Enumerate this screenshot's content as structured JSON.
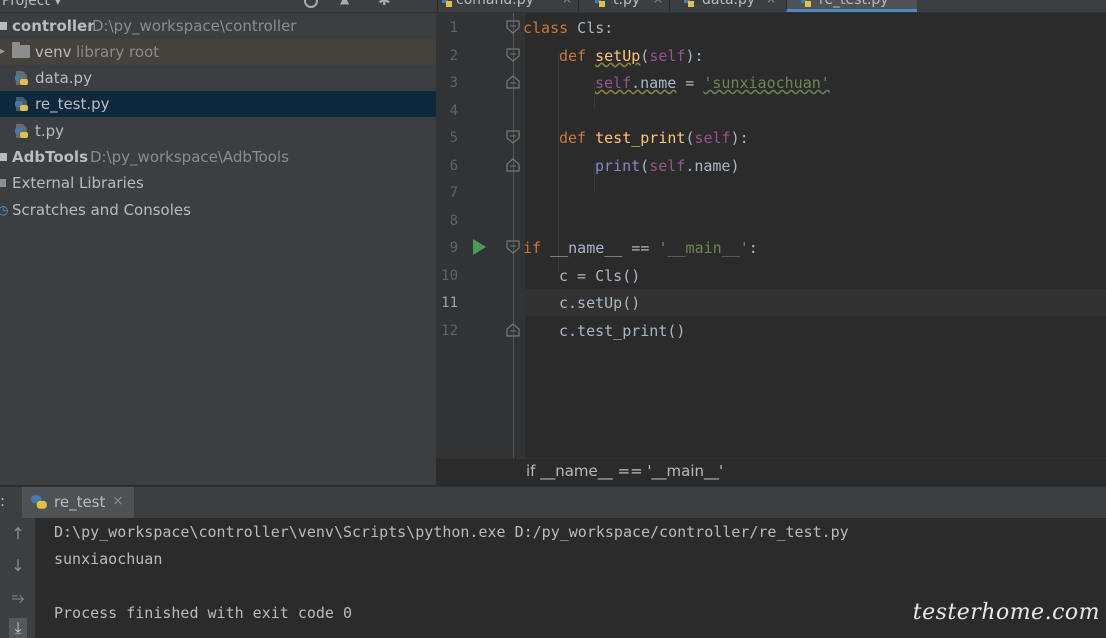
{
  "project_panel": {
    "title": "Project ▾"
  },
  "editor_tabs": [
    {
      "label": "comand.py",
      "active": false
    },
    {
      "label": "t.py",
      "active": false
    },
    {
      "label": "data.py",
      "active": false
    },
    {
      "label": "re_test.py",
      "active": true
    }
  ],
  "tree": {
    "items": [
      {
        "name": "controller",
        "path": "D:\\py_workspace\\controller"
      },
      {
        "name": "venv",
        "path": "library root"
      },
      {
        "name": "data.py"
      },
      {
        "name": "re_test.py"
      },
      {
        "name": "t.py"
      },
      {
        "name": "AdbTools",
        "path": "D:\\py_workspace\\AdbTools"
      },
      {
        "name": "External Libraries"
      },
      {
        "name": "Scratches and Consoles"
      }
    ]
  },
  "editor": {
    "line_numbers": [
      "1",
      "2",
      "3",
      "4",
      "5",
      "6",
      "7",
      "8",
      "9",
      "10",
      "11",
      "12"
    ],
    "current_line": "11",
    "code": {
      "l1_kw": "class",
      "l1_rest": " Cls:",
      "l2_kw": "def",
      "l2_fn": "setUp",
      "l2_p1": "(",
      "l2_self": "self",
      "l2_p2": "):",
      "l3_self": "self",
      "l3_attr": ".name",
      "l3_eq": " = ",
      "l3_str": "'sunxiaochuan'",
      "l5_kw": "def",
      "l5_fn": "test_print",
      "l5_p1": "(",
      "l5_self": "self",
      "l5_p2": "):",
      "l6_print": "print",
      "l6_p1": "(",
      "l6_self": "self",
      "l6_rest": ".name)",
      "l9_kw": "if",
      "l9_mid": " __name__ == ",
      "l9_str": "'__main__'",
      "l9_end": ":",
      "l10": "c = Cls()",
      "l11": "c.setUp()",
      "l12": "c.test_print()"
    },
    "breadcrumb": "if __name__ == '__main__'"
  },
  "run_panel": {
    "prefix": ":",
    "tab_label": "re_test",
    "close": "×",
    "console": [
      "D:\\py_workspace\\controller\\venv\\Scripts\\python.exe D:/py_workspace/controller/re_test.py",
      "sunxiaochuan",
      "",
      "Process finished with exit code 0"
    ]
  },
  "watermark": "testerhome.com",
  "colors": {
    "keyword": "#cc7832",
    "function": "#ffc66d",
    "self": "#94558d",
    "string": "#6a8759",
    "run_green": "#499c54",
    "selection": "#0d293e"
  }
}
